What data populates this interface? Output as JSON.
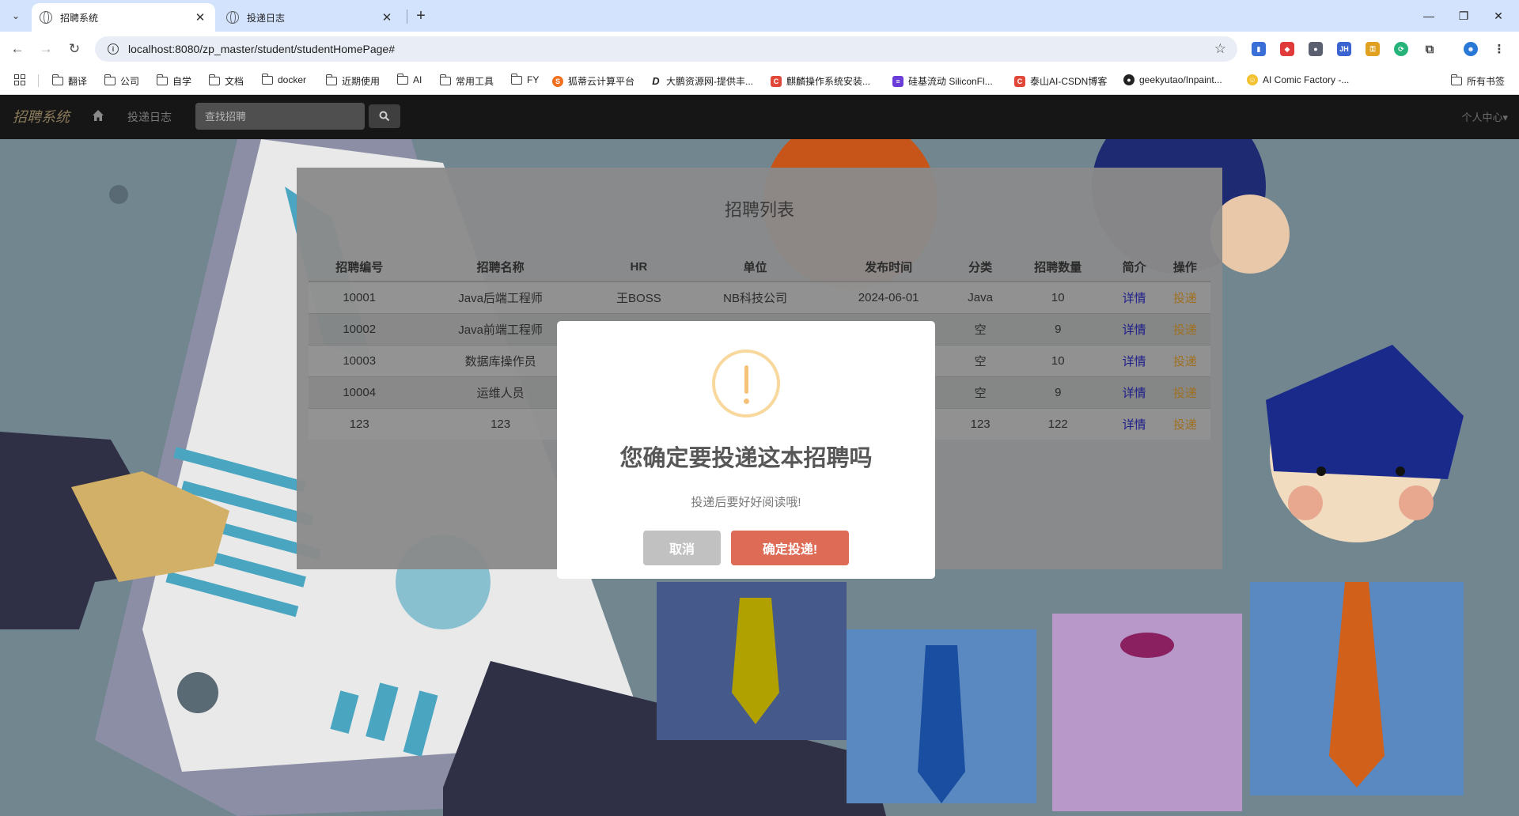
{
  "browser": {
    "tabs": [
      {
        "title": "招聘系统",
        "active": true
      },
      {
        "title": "投递日志",
        "active": false
      }
    ],
    "url": "localhost:8080/zp_master/student/studentHomePage#",
    "bookmarks": [
      {
        "label": "翻译",
        "type": "folder"
      },
      {
        "label": "公司",
        "type": "folder"
      },
      {
        "label": "自学",
        "type": "folder"
      },
      {
        "label": "文档",
        "type": "folder"
      },
      {
        "label": "docker",
        "type": "folder"
      },
      {
        "label": "近期使用",
        "type": "folder"
      },
      {
        "label": "AI",
        "type": "folder"
      },
      {
        "label": "常用工具",
        "type": "folder"
      },
      {
        "label": "FY",
        "type": "folder"
      },
      {
        "label": "狐蒂云计算平台",
        "type": "site"
      },
      {
        "label": "大鹏资源网-提供丰...",
        "type": "site"
      },
      {
        "label": "麒麟操作系统安装...",
        "type": "site"
      },
      {
        "label": "硅基流动 SiliconFl...",
        "type": "site"
      },
      {
        "label": "泰山AI-CSDN博客",
        "type": "site"
      },
      {
        "label": "geekyutao/Inpaint...",
        "type": "site"
      },
      {
        "label": "AI Comic Factory -...",
        "type": "site"
      }
    ],
    "all_bookmarks_label": "所有书签"
  },
  "navbar": {
    "brand": "招聘系统",
    "link_log": "投递日志",
    "search_placeholder": "查找招聘",
    "user_menu": "个人中心▾"
  },
  "panel": {
    "title": "招聘列表",
    "columns": [
      "招聘编号",
      "招聘名称",
      "HR",
      "单位",
      "发布时间",
      "分类",
      "招聘数量",
      "简介",
      "操作"
    ],
    "rows": [
      {
        "id": "10001",
        "name": "Java后端工程师",
        "hr": "王BOSS",
        "unit": "NB科技公司",
        "date": "2024-06-01",
        "category": "Java",
        "count": "10",
        "detail": "详情",
        "action": "投递"
      },
      {
        "id": "10002",
        "name": "Java前端工程师",
        "hr": "",
        "unit": "",
        "date": "",
        "category": "空",
        "count": "9",
        "detail": "详情",
        "action": "投递"
      },
      {
        "id": "10003",
        "name": "数据库操作员",
        "hr": "",
        "unit": "",
        "date": "",
        "category": "空",
        "count": "10",
        "detail": "详情",
        "action": "投递"
      },
      {
        "id": "10004",
        "name": "运维人员",
        "hr": "",
        "unit": "",
        "date": "",
        "category": "空",
        "count": "9",
        "detail": "详情",
        "action": "投递"
      },
      {
        "id": "123",
        "name": "123",
        "hr": "",
        "unit": "",
        "date": "",
        "category": "123",
        "count": "122",
        "detail": "详情",
        "action": "投递"
      }
    ]
  },
  "modal": {
    "icon": "warning-icon",
    "title": "您确定要投递这本招聘吗",
    "text": "投递后要好好阅读哦!",
    "cancel_label": "取消",
    "confirm_label": "确定投递!"
  },
  "colors": {
    "navbar_bg": "#161616",
    "confirm_button": "#dd6b55",
    "cancel_button": "#c1c1c1",
    "warning": "#f8d89c"
  }
}
